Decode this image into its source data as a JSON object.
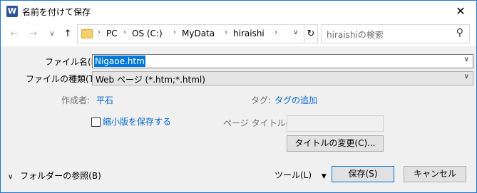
{
  "window": {
    "app_icon_letter": "W",
    "title": "名前を付けて保存",
    "close_glyph": "✕"
  },
  "nav": {
    "back_glyph": "←",
    "forward_glyph": "→",
    "dropdown_glyph": "∨",
    "up_glyph": "↑",
    "breadcrumb": [
      "PC",
      "OS (C:)",
      "MyData",
      "hiraishi"
    ],
    "sep_glyph": "›",
    "refresh_glyph": "↻",
    "search_placeholder": "hiraishiの検索",
    "search_glyph": "⚲"
  },
  "form": {
    "filename_label": "ファイル名(N):",
    "filename_value": "Nigaoe.htm",
    "filetype_label": "ファイルの種類(T):",
    "filetype_value": "Web ページ (*.htm;*.html)",
    "author_label": "作成者:",
    "author_value": "平石",
    "tags_label": "タグ:",
    "tags_value": "タグの追加",
    "thumbnail_label": "縮小版を保存する",
    "thumbnail_checked": false,
    "page_title_label": "ページ タイトル(T):",
    "page_title_value": "",
    "change_title_button": "タイトルの変更(C)..."
  },
  "footer": {
    "browse_folders": "フォルダーの参照(B)",
    "browse_glyph": "∨",
    "tools": "ツール(L)",
    "tools_glyph": "▼",
    "save": "保存(S)",
    "cancel": "キャンセル"
  },
  "colors": {
    "accent": "#0078d7",
    "link": "#0066cc",
    "border": "#1f78d1"
  }
}
